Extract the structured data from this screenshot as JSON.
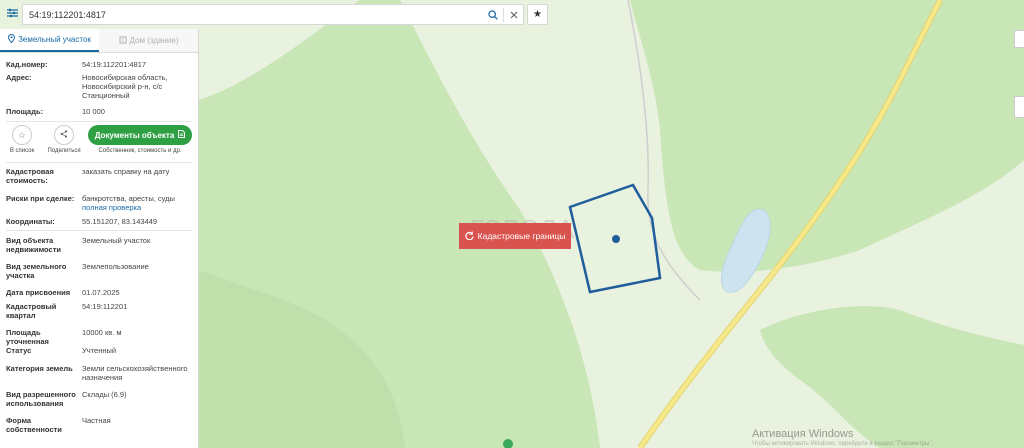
{
  "search": {
    "value": "54:19:112201:4817"
  },
  "tabs": [
    {
      "label": "Земельный участок",
      "icon": "map-pin-icon",
      "active": true
    },
    {
      "label": "Дом (здание)",
      "icon": "building-icon",
      "active": false
    }
  ],
  "fields_top": [
    {
      "label": "Кад.номер:",
      "value": "54:19:112201:4817",
      "link": true
    },
    {
      "label": "Адрес:",
      "value": "Новосибирская область, Новосибирский р-н, с/с Станционный"
    },
    {
      "label": "Площадь:",
      "value": "10 000"
    }
  ],
  "actions": {
    "add_to_list": "В список",
    "share": "Поделиться",
    "docs_button": "Документы объекта",
    "docs_sub": "Собственник, стоимость и др."
  },
  "fields_mid": {
    "cad_cost_label": "Кадастровая стоимость:",
    "cad_cost_link": "заказать справку на дату",
    "risks_label": "Риски при сделке:",
    "risks_value": "банкротства, аресты, суды",
    "risks_link": "полная проверка",
    "coords_label": "Координаты:",
    "coords_value": "55.151207, 83.143449"
  },
  "fields_bottom": [
    {
      "label": "Вид объекта недвижимости",
      "value": "Земельный участок"
    },
    {
      "label": "Вид земельного участка",
      "value": "Землепользование"
    },
    {
      "label": "Дата присвоения",
      "value": "01.07.2025"
    },
    {
      "label": "Кадастровый квартал",
      "value": "54:19:112201"
    },
    {
      "label": "Площадь уточненная",
      "value": "10000 кв. м"
    },
    {
      "label": "Статус",
      "value": "Учтенный"
    },
    {
      "label": "Категория земель",
      "value": "Земли сельскохозяйственного назначения"
    },
    {
      "label": "Вид разрешенного использования",
      "value": "Склады (6.9)"
    },
    {
      "label": "Форма собственности",
      "value": "Частная"
    }
  ],
  "map": {
    "cadastral_button": "Кадастровые границы",
    "watermark_logo": "ГОРОДА",
    "windows_title": "Активация Windows",
    "windows_sub": "Чтобы активировать Windows, перейдите в раздел \"Параметры\".",
    "colors": {
      "forest": "#c8e6b6",
      "field": "#e9f1df",
      "road": "#f2e27a",
      "water": "#cde4f0",
      "parcel": "#1f5e9a"
    }
  }
}
